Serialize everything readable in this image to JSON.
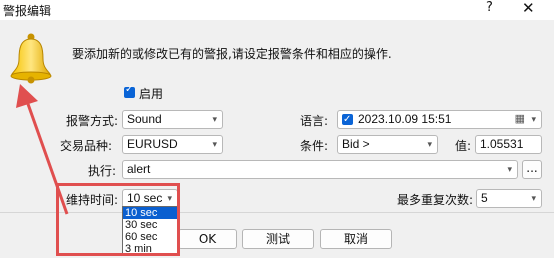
{
  "window": {
    "title": "警报编辑",
    "help": "?",
    "close": "✕"
  },
  "intro": "要添加新的或修改已有的警报,请设定报警条件和相应的操作.",
  "enable": {
    "label": "启用",
    "checked": true
  },
  "fields": {
    "alert_type": {
      "label": "报警方式:",
      "value": "Sound"
    },
    "symbol": {
      "label": "交易品种:",
      "value": "EURUSD"
    },
    "execute": {
      "label": "执行:",
      "value": "alert",
      "browse": "..."
    },
    "timeout": {
      "label": "维持时间:",
      "value": "10 sec"
    },
    "language": {
      "label": "语言:",
      "value": "2023.10.09 15:51"
    },
    "condition": {
      "label": "条件:",
      "value": "Bid >"
    },
    "value": {
      "label": "值:",
      "value": "1.05531"
    },
    "max_repeats": {
      "label": "最多重复次数:",
      "value": "5"
    }
  },
  "timeout_options": [
    "10 sec",
    "30 sec",
    "60 sec",
    "3 min"
  ],
  "buttons": {
    "ok": "OK",
    "test": "测试",
    "cancel": "取消"
  },
  "colors": {
    "accent": "#0a64d6",
    "annotation": "#e04f4f"
  }
}
